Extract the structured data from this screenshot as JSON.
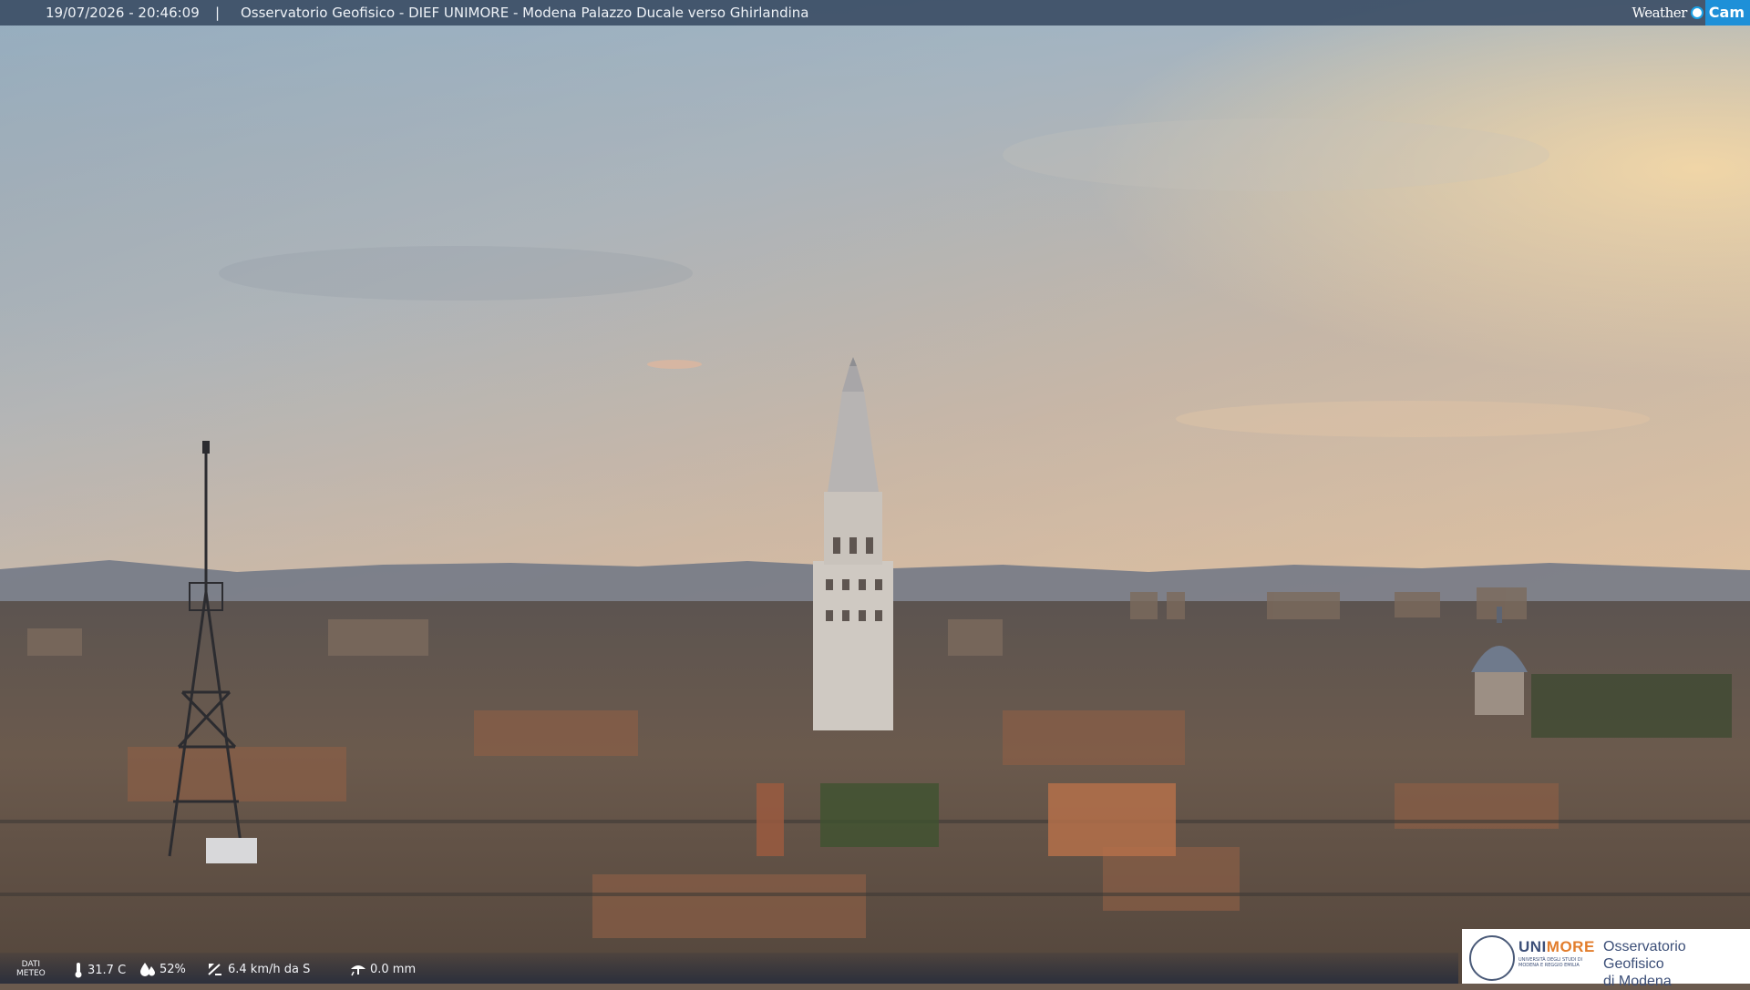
{
  "header": {
    "datetime": "19/07/2026 - 20:46:09",
    "separator": "|",
    "title": "Osservatorio Geofisico - DIEF UNIMORE - Modena Palazzo Ducale verso Ghirlandina"
  },
  "brand": {
    "weather": "Weather",
    "cam": "Cam"
  },
  "weather_strip": {
    "label_line1": "DATI",
    "label_line2": "METEO",
    "temperature": "31.7 C",
    "humidity": "52%",
    "wind": "6.4 km/h da S",
    "rain": "0.0 mm",
    "icons": [
      "thermometer-icon",
      "humidity-icon",
      "wind-icon",
      "rain-icon"
    ]
  },
  "logo": {
    "uni_part1": "UNI",
    "uni_part2": "MORE",
    "subtitle": "UNIVERSITÀ DEGLI STUDI DI MODENA E REGGIO EMILIA",
    "obs_line1": "Osservatorio Geofisico",
    "obs_line2": "di Modena"
  },
  "colors": {
    "bar": "#3c4e66",
    "accent": "#1e90d8",
    "unimore_blue": "#3c4f78",
    "unimore_orange": "#e27d2c"
  }
}
